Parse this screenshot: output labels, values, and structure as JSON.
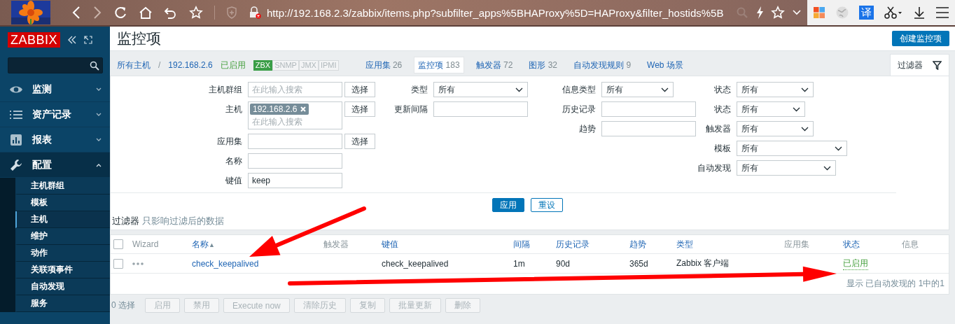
{
  "browser": {
    "url": "http://192.168.2.3/zabbix/items.php?subfilter_apps%5BHAProxy%5D=HAProxy&filter_hostids%5B",
    "translate_badge": "译"
  },
  "sidebar": {
    "logo": "ZABBIX",
    "menu": [
      {
        "label": "监测",
        "expanded": false
      },
      {
        "label": "资产记录",
        "expanded": false
      },
      {
        "label": "报表",
        "expanded": false
      },
      {
        "label": "配置",
        "expanded": true,
        "children": [
          {
            "label": "主机群组",
            "selected": false
          },
          {
            "label": "模板",
            "selected": false
          },
          {
            "label": "主机",
            "selected": true
          },
          {
            "label": "维护",
            "selected": false
          },
          {
            "label": "动作",
            "selected": false
          },
          {
            "label": "关联项事件",
            "selected": false
          },
          {
            "label": "自动发现",
            "selected": false
          },
          {
            "label": "服务",
            "selected": false
          }
        ]
      }
    ]
  },
  "page": {
    "title": "监控项",
    "create_button": "创建监控项"
  },
  "host_nav": {
    "breadcrumb": [
      "所有主机",
      "192.168.2.6"
    ],
    "separator": "/",
    "status": "已启用",
    "availability": [
      {
        "label": "ZBX",
        "available": true
      },
      {
        "label": "SNMP",
        "available": false
      },
      {
        "label": "JMX",
        "available": false
      },
      {
        "label": "IPMI",
        "available": false
      }
    ],
    "tabs": [
      {
        "label": "应用集",
        "count": "26",
        "selected": false
      },
      {
        "label": "监控项",
        "count": "183",
        "selected": true
      },
      {
        "label": "触发器",
        "count": "72",
        "selected": false
      },
      {
        "label": "图形",
        "count": "32",
        "selected": false
      },
      {
        "label": "自动发现规则",
        "count": "9",
        "selected": false
      },
      {
        "label": "Web 场景",
        "selected": false
      }
    ]
  },
  "filter": {
    "tab_label": "过滤器",
    "columns": [
      [
        {
          "label": "主机群组",
          "kind": "multiselect",
          "placeholder": "在此输入搜索",
          "button": "选择"
        },
        {
          "label": "主机",
          "kind": "multiselect",
          "tags": [
            "192.168.2.6"
          ],
          "placeholder": "在此输入搜索",
          "button": "选择"
        },
        {
          "label": "应用集",
          "kind": "text",
          "button": "选择"
        },
        {
          "label": "名称",
          "kind": "text"
        },
        {
          "label": "键值",
          "kind": "text",
          "value": "keep"
        }
      ],
      [
        {
          "label": "类型",
          "kind": "select",
          "value": "所有"
        },
        {
          "label": "更新间隔",
          "kind": "text"
        }
      ],
      [
        {
          "label": "信息类型",
          "kind": "select",
          "value": "所有"
        },
        {
          "label": "历史记录",
          "kind": "text"
        },
        {
          "label": "趋势",
          "kind": "text"
        }
      ],
      [
        {
          "label": "状态",
          "kind": "select",
          "value": "所有"
        },
        {
          "label": "状态",
          "kind": "select",
          "value": "所有"
        },
        {
          "label": "触发器",
          "kind": "select",
          "value": "所有"
        },
        {
          "label": "模板",
          "kind": "select",
          "value": "所有"
        },
        {
          "label": "自动发现",
          "kind": "select",
          "value": "所有"
        }
      ]
    ],
    "apply": "应用",
    "reset": "重设"
  },
  "subfilter": {
    "title": "过滤器",
    "note": "只影响过滤后的数据"
  },
  "table": {
    "select_all": {
      "checked": false
    },
    "columns": [
      {
        "label": "Wizard",
        "sortable": false
      },
      {
        "label": "名称",
        "sortable": true,
        "sort_indicator": "▲"
      },
      {
        "label": "触发器",
        "sortable": false
      },
      {
        "label": "键值",
        "sortable": true
      },
      {
        "label": "间隔",
        "sortable": true
      },
      {
        "label": "历史记录",
        "sortable": true
      },
      {
        "label": "趋势",
        "sortable": true
      },
      {
        "label": "类型",
        "sortable": true
      },
      {
        "label": "应用集",
        "sortable": false
      },
      {
        "label": "状态",
        "sortable": true
      },
      {
        "label": "信息",
        "sortable": false
      }
    ],
    "rows": [
      {
        "checked": false,
        "name": "check_keepalived",
        "key": "check_keepalived",
        "interval": "1m",
        "history": "90d",
        "trends": "365d",
        "type": "Zabbix 客户端",
        "status": "已启用"
      }
    ],
    "footer": "显示 已自动发现的 1中的1"
  },
  "actions": {
    "selected_count": "0 选择",
    "buttons": [
      {
        "label": "启用",
        "disabled": true
      },
      {
        "label": "禁用",
        "disabled": true
      },
      {
        "label": "Execute now",
        "disabled": true
      },
      {
        "label": "清除历史",
        "disabled": true
      },
      {
        "label": "复制",
        "disabled": true
      },
      {
        "label": "批量更新",
        "disabled": true
      },
      {
        "label": "删除",
        "disabled": true
      }
    ]
  },
  "annotations": [
    {
      "kind": "arrow"
    },
    {
      "kind": "arrow"
    }
  ]
}
